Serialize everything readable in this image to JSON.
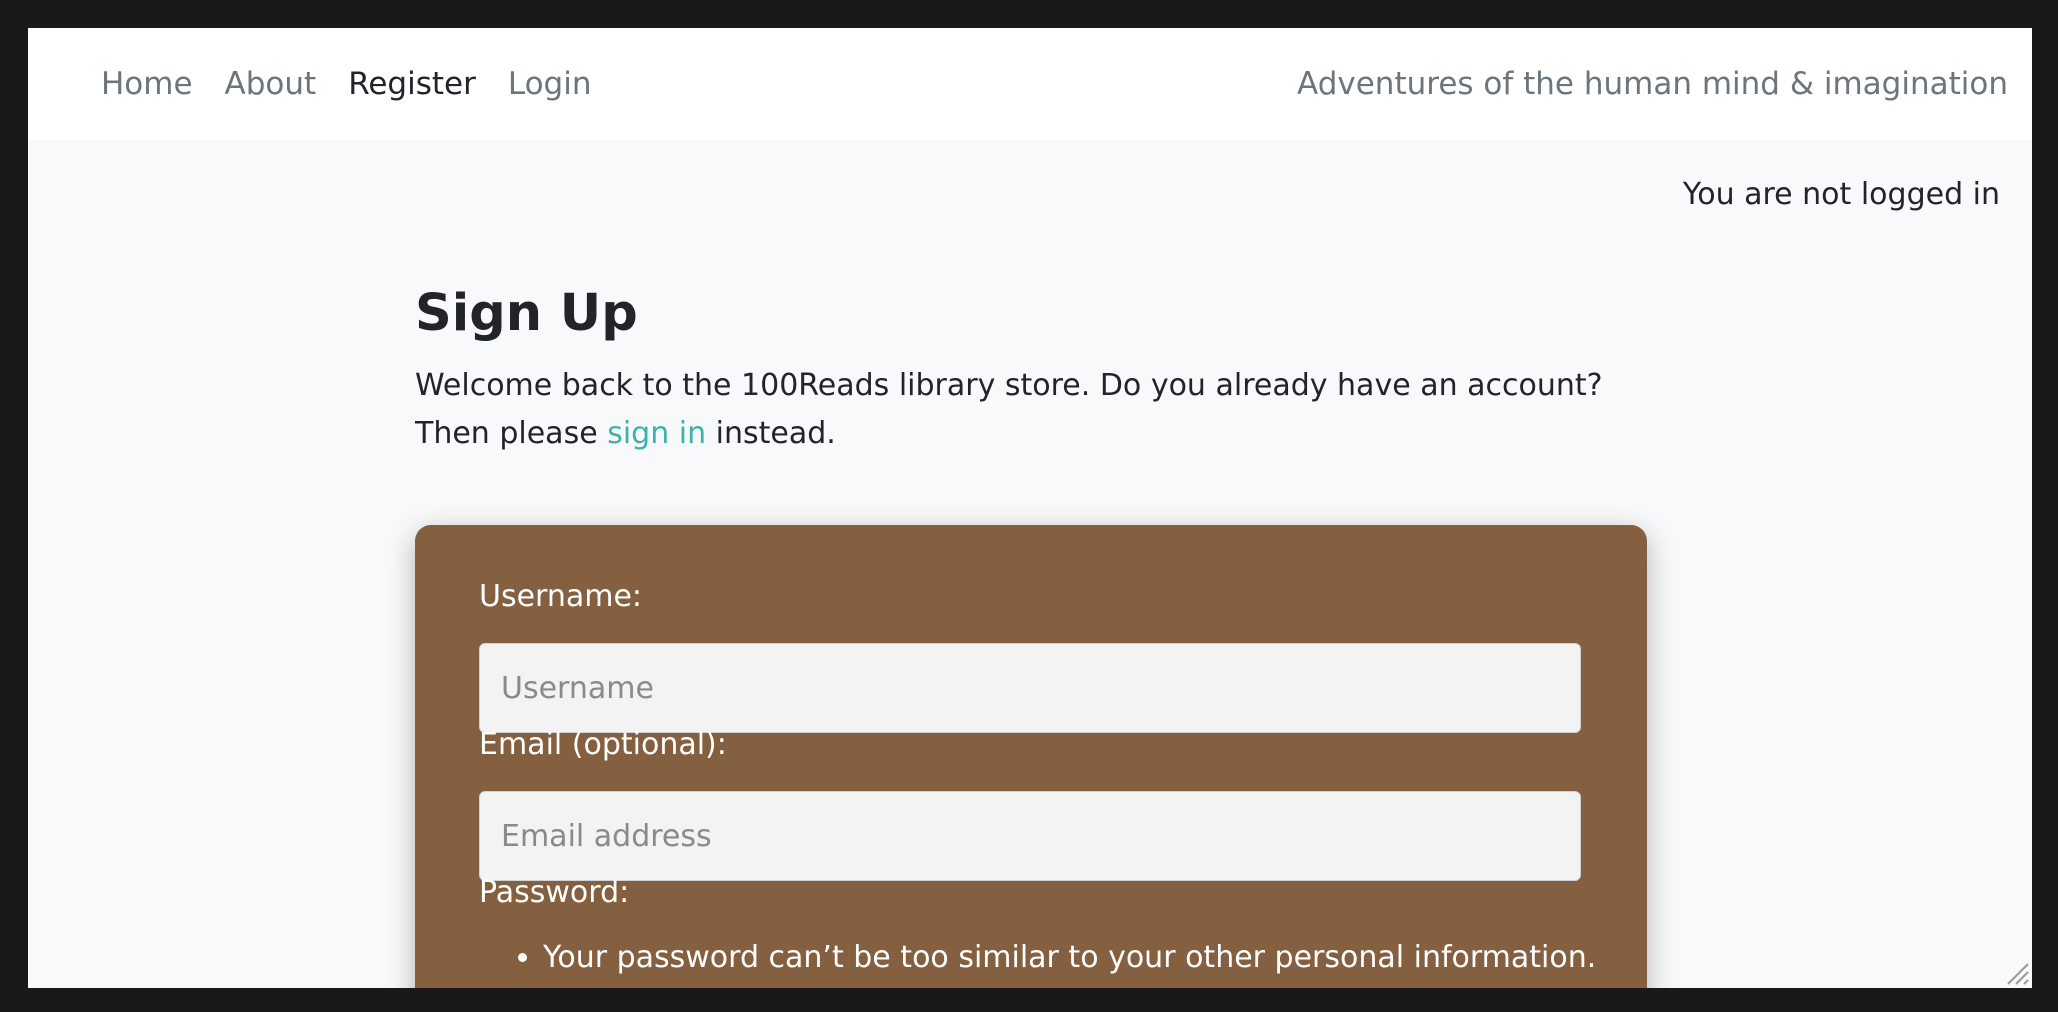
{
  "nav": {
    "items": [
      {
        "label": "Home",
        "active": false
      },
      {
        "label": "About",
        "active": false
      },
      {
        "label": "Register",
        "active": true
      },
      {
        "label": "Login",
        "active": false
      }
    ],
    "tagline": "Adventures of the human mind & imagination"
  },
  "status": {
    "login_text": "You are not logged in"
  },
  "page": {
    "title": "Sign Up",
    "intro_before": "Welcome back to the 100Reads library store. Do you already have an account? Then please ",
    "intro_link": "sign in",
    "intro_after": " instead."
  },
  "form": {
    "username_label": "Username:",
    "username_placeholder": "Username",
    "email_label": "Email (optional):",
    "email_placeholder": "Email address",
    "password_label": "Password:",
    "password_help": [
      "Your password can’t be too similar to your other personal information."
    ]
  },
  "colors": {
    "frame": "#19191b",
    "page_bg": "#f8f9fa",
    "navbar_bg": "#ffffff",
    "card_bg": "#845f40",
    "link": "#3fb1ac",
    "muted_text": "#6c757d"
  },
  "icons": {
    "resize_grip": "resize-grip-icon"
  }
}
